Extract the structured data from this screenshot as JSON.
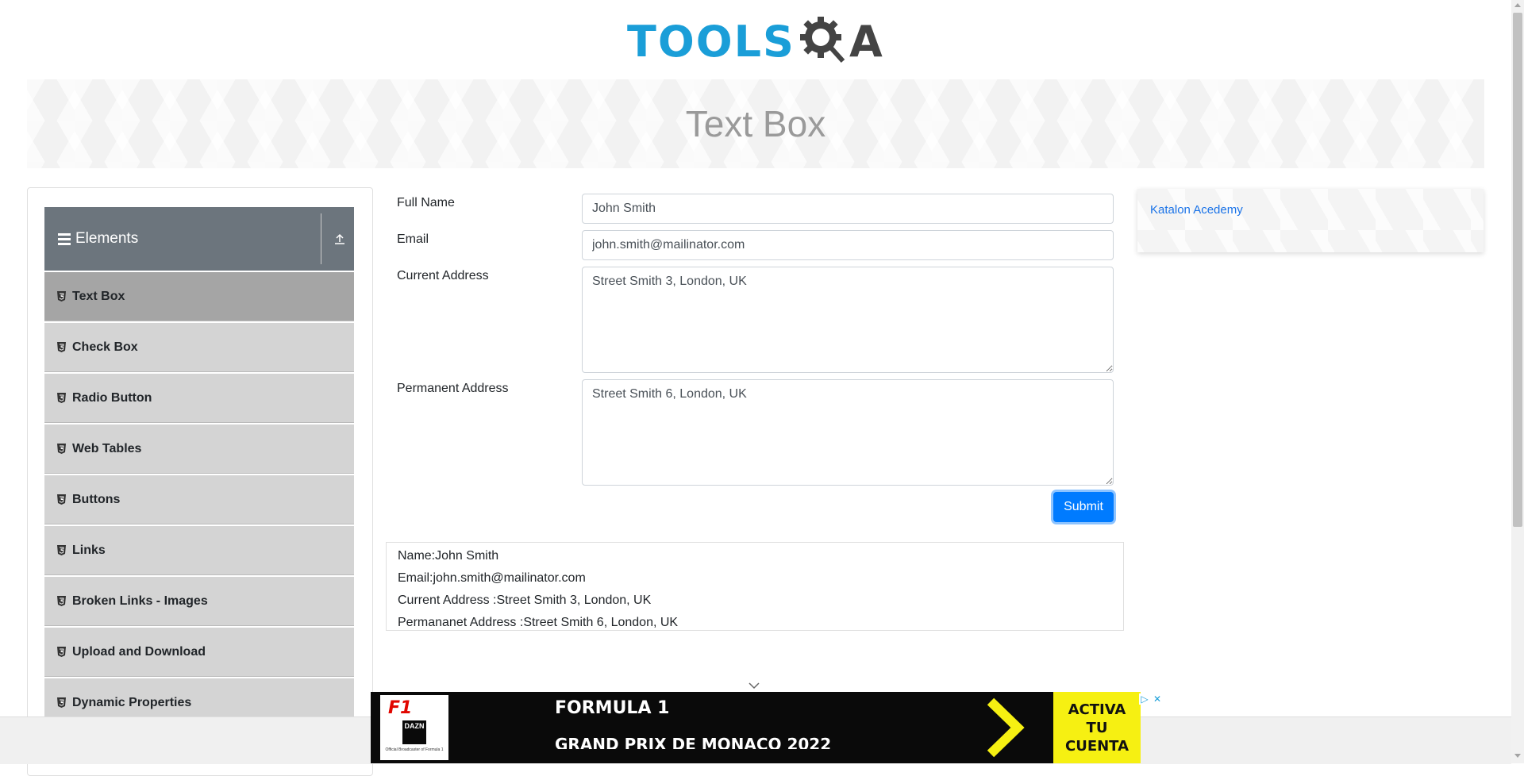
{
  "header": {
    "logo_text": "TOOLS",
    "logo_text_end": "A",
    "logo_icon": "gear-magnifier-icon"
  },
  "banner": {
    "title": "Text Box"
  },
  "sidebar": {
    "group_title": "Elements",
    "items": [
      {
        "label": "Text Box",
        "active": true
      },
      {
        "label": "Check Box"
      },
      {
        "label": "Radio Button"
      },
      {
        "label": "Web Tables"
      },
      {
        "label": "Buttons"
      },
      {
        "label": "Links"
      },
      {
        "label": "Broken Links - Images"
      },
      {
        "label": "Upload and Download"
      },
      {
        "label": "Dynamic Properties"
      }
    ]
  },
  "form": {
    "full_name_label": "Full Name",
    "full_name_value": "John Smith",
    "email_label": "Email",
    "email_value": "john.smith@mailinator.com",
    "current_address_label": "Current Address",
    "current_address_value": "Street Smith 3, London, UK",
    "permanent_address_label": "Permanent Address",
    "permanent_address_value": "Street Smith 6, London, UK",
    "submit_label": "Submit"
  },
  "output": {
    "name": "Name:John Smith",
    "email": "Email:john.smith@mailinator.com",
    "current_address": "Current Address :Street Smith 3, London, UK",
    "permanent_address": "Permananet Address :Street Smith 6, London, UK"
  },
  "right_ad": {
    "alt_text": "Katalon Acedemy"
  },
  "bottom_ad": {
    "brand": "F1",
    "partner": "DAZN",
    "small_text": "Official Broadcaster of Formula 1",
    "title": "FORMULA 1",
    "subtitle": "GRAND PRIX DE MONACO 2022",
    "cta_line1": "ACTIVA",
    "cta_line2": "TU",
    "cta_line3": "CUENTA"
  },
  "colors": {
    "primary": "#007bff",
    "sidebar_header": "#6c757d",
    "menu_active": "#a5a5a5",
    "menu_item": "#d4d4d4",
    "logo_blue": "#1a9ed8",
    "cta_yellow": "#f6f012"
  }
}
